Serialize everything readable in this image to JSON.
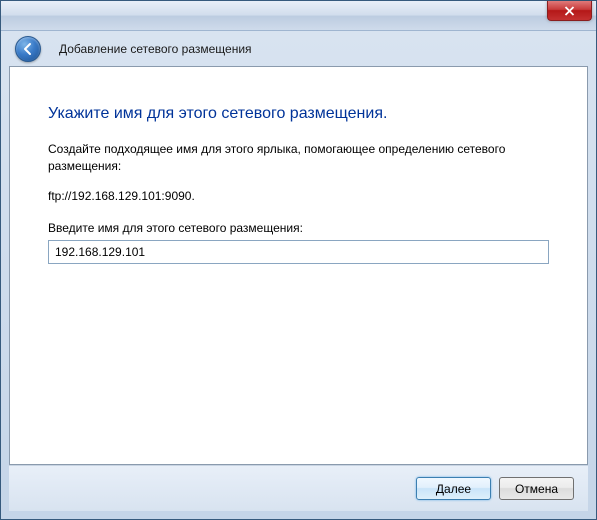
{
  "wizard": {
    "title": "Добавление сетевого размещения"
  },
  "page": {
    "heading": "Укажите имя для этого сетевого размещения.",
    "description": "Создайте подходящее имя для этого ярлыка, помогающее определению сетевого размещения:",
    "address": "ftp://192.168.129.101:9090.",
    "input_label": "Введите имя для этого сетевого размещения:",
    "input_value": "192.168.129.101"
  },
  "buttons": {
    "next": "Далее",
    "cancel": "Отмена"
  }
}
